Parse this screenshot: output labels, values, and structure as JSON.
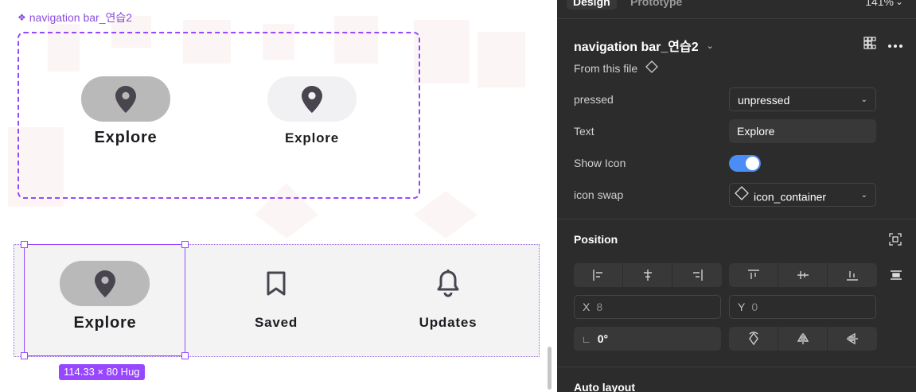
{
  "canvas": {
    "component_label": "navigation bar_연습2",
    "variants": [
      {
        "label": "Explore",
        "state": "pressed"
      },
      {
        "label": "Explore",
        "state": "unpressed"
      }
    ],
    "navbar_items": [
      {
        "label": "Explore",
        "icon": "location-pin-icon",
        "selected": true
      },
      {
        "label": "Saved",
        "icon": "bookmark-icon"
      },
      {
        "label": "Updates",
        "icon": "bell-icon"
      }
    ],
    "selection_size": "114.33 × 80 Hug",
    "colors": {
      "accent": "#9747ff",
      "pill_pressed": "#b9b9b9",
      "pill_unpressed": "#f1f1f3",
      "icon": "#49454f"
    }
  },
  "panel": {
    "tabs": {
      "design": "Design",
      "prototype": "Prototype",
      "zoom": "141%"
    },
    "instance_name": "navigation bar_연습2",
    "from_file": "From this file",
    "props": {
      "pressed_label": "pressed",
      "pressed_value": "unpressed",
      "text_label": "Text",
      "text_value": "Explore",
      "show_icon_label": "Show Icon",
      "show_icon_value": true,
      "icon_swap_label": "icon swap",
      "icon_swap_value": "icon_container"
    },
    "position": {
      "title": "Position",
      "x_label": "X",
      "x_value": "8",
      "y_label": "Y",
      "y_value": "0",
      "rotation": "0°"
    },
    "auto_layout_title": "Auto layout",
    "colors": {
      "panel_bg": "#2c2c2c",
      "toggle_on": "#4a8ef5"
    }
  }
}
